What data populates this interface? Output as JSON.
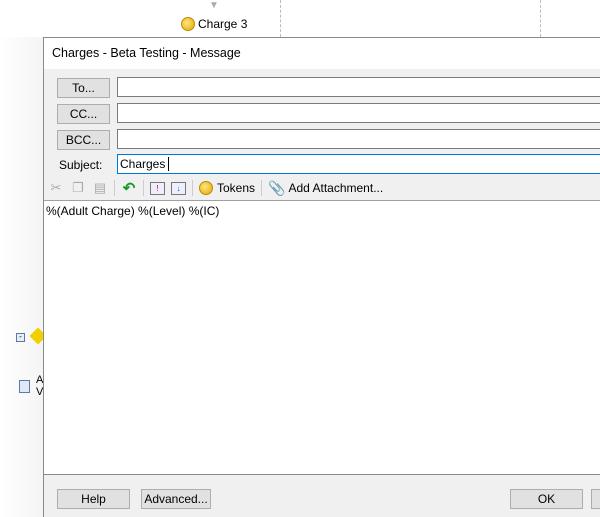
{
  "background": {
    "node_label": "Charge 3",
    "partial_item_letters": "A\nV"
  },
  "dialog": {
    "title": "Charges - Beta Testing - Message",
    "to_button": "To...",
    "cc_button": "CC...",
    "bcc_button": "BCC...",
    "to_value": "",
    "cc_value": "",
    "bcc_value": "",
    "subject_label": "Subject:",
    "subject_value": "Charges",
    "toolbar": {
      "tokens_label": "Tokens",
      "attachment_label": "Add Attachment..."
    },
    "body_text": "%(Adult Charge) %(Level) %(IC)",
    "footer": {
      "help": "Help",
      "advanced": "Advanced...",
      "ok": "OK"
    }
  }
}
